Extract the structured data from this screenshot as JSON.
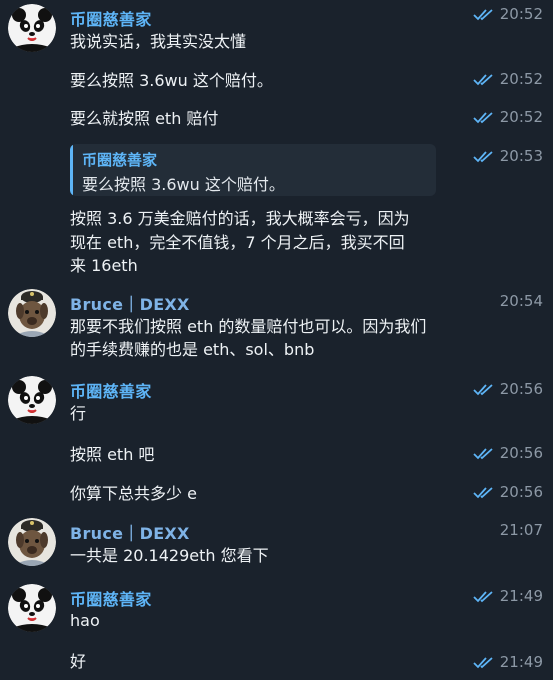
{
  "senders": {
    "panda": "币圈慈善家",
    "bruce": "Bruce｜DEXX"
  },
  "messages": [
    {
      "text": "我说实话，我其实没太懂",
      "time": "20:52"
    },
    {
      "text": "要么按照 3.6wu 这个赔付。",
      "time": "20:52"
    },
    {
      "text": "要么就按照 eth 赔付",
      "time": "20:52"
    },
    {
      "reply_name": "币圈慈善家",
      "reply_text": "要么按照 3.6wu 这个赔付。",
      "time": "20:53"
    },
    {
      "lines": [
        "按照 3.6 万美金赔付的话，我大概率会亏，因为",
        "现在 eth，完全不值钱，7 个月之后，我买不回",
        "来 16eth"
      ]
    },
    {
      "lines": [
        "那要不我们按照 eth 的数量赔付也可以。因为我们",
        "的手续费赚的也是 eth、sol、bnb"
      ],
      "time": "20:54"
    },
    {
      "text": "行",
      "time": "20:56"
    },
    {
      "text": "按照 eth 吧",
      "time": "20:56"
    },
    {
      "text": "你算下总共多少 e",
      "time": "20:56"
    },
    {
      "text": "一共是 20.1429eth 您看下",
      "time": "21:07"
    },
    {
      "text": "hao",
      "time": "21:49"
    },
    {
      "text": "好",
      "time": "21:49"
    }
  ],
  "colors": {
    "background": "#1a222c",
    "sender_blue": "#5eb5f7",
    "tick_blue": "#5eb5f7",
    "time_gray": "#8d99a6"
  },
  "icons": {
    "read_receipt": "double-check-icon",
    "panda_avatar": "panda-avatar",
    "bruce_avatar": "dog-avatar"
  }
}
